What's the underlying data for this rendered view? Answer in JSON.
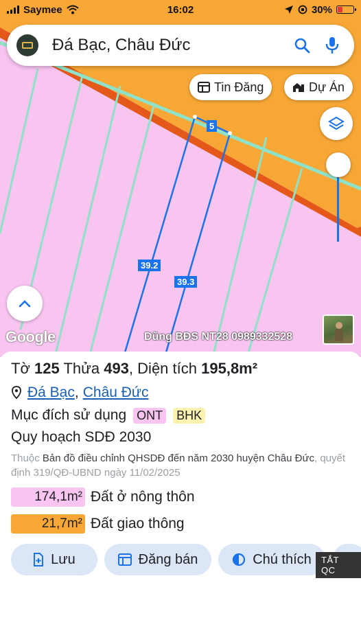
{
  "status_bar": {
    "carrier": "Saymee",
    "time": "16:02",
    "battery_percent": "30%",
    "battery_level": 0.3
  },
  "search": {
    "query": "Đá Bạc, Châu Đức",
    "logo_icon": "app-logo-icon",
    "search_icon": "search-icon",
    "mic_icon": "mic-icon"
  },
  "map": {
    "buttons": {
      "listings_label": "Tin Đăng",
      "projects_label": "Dự Án"
    },
    "dimension_labels": [
      "5",
      "39.2",
      "39.3"
    ],
    "google_label": "Google",
    "watermark": "Dũng BĐS NT28 0989332528",
    "colors": {
      "residential": "#f8c4f0",
      "road": "#f7a735",
      "road_edge": "#e4591a",
      "parcel_line": "#8fe2c8",
      "boundary": "#1a73e8"
    }
  },
  "parcel": {
    "sheet_label": "Tờ",
    "sheet_number": "125",
    "plot_label": "Thửa",
    "plot_number": "493",
    "area_label": "Diện tích",
    "area_value": "195,8m²",
    "location": {
      "commune": "Đá Bạc",
      "separator": ",",
      "district": "Châu Đức"
    },
    "purpose_label": "Mục đích sử dụng",
    "purpose_tags": [
      {
        "code": "ONT",
        "color": "#f8c4f0"
      },
      {
        "code": "BHK",
        "color": "#fdf3b0"
      }
    ],
    "planning_title": "Quy hoạch SDĐ 2030",
    "belongs": {
      "prefix": "Thuộc",
      "map_name": "Bản đồ điều chỉnh QHSDĐ đến năm 2030 huyện Châu Đức",
      "decision": ", quyết định 319/QĐ-UBND ngày 11/02/2025"
    },
    "land_use_breakdown": [
      {
        "area": "174,1m²",
        "label": "Đất ở nông thôn",
        "color": "#f8c4f0"
      },
      {
        "area": "21,7m²",
        "label": "Đất giao thông",
        "color": "#f7a735"
      }
    ]
  },
  "actions": {
    "save_label": "Lưu",
    "sell_label": "Đăng bán",
    "legend_label": "Chú thích"
  },
  "ad_badge": "TẮT QC"
}
